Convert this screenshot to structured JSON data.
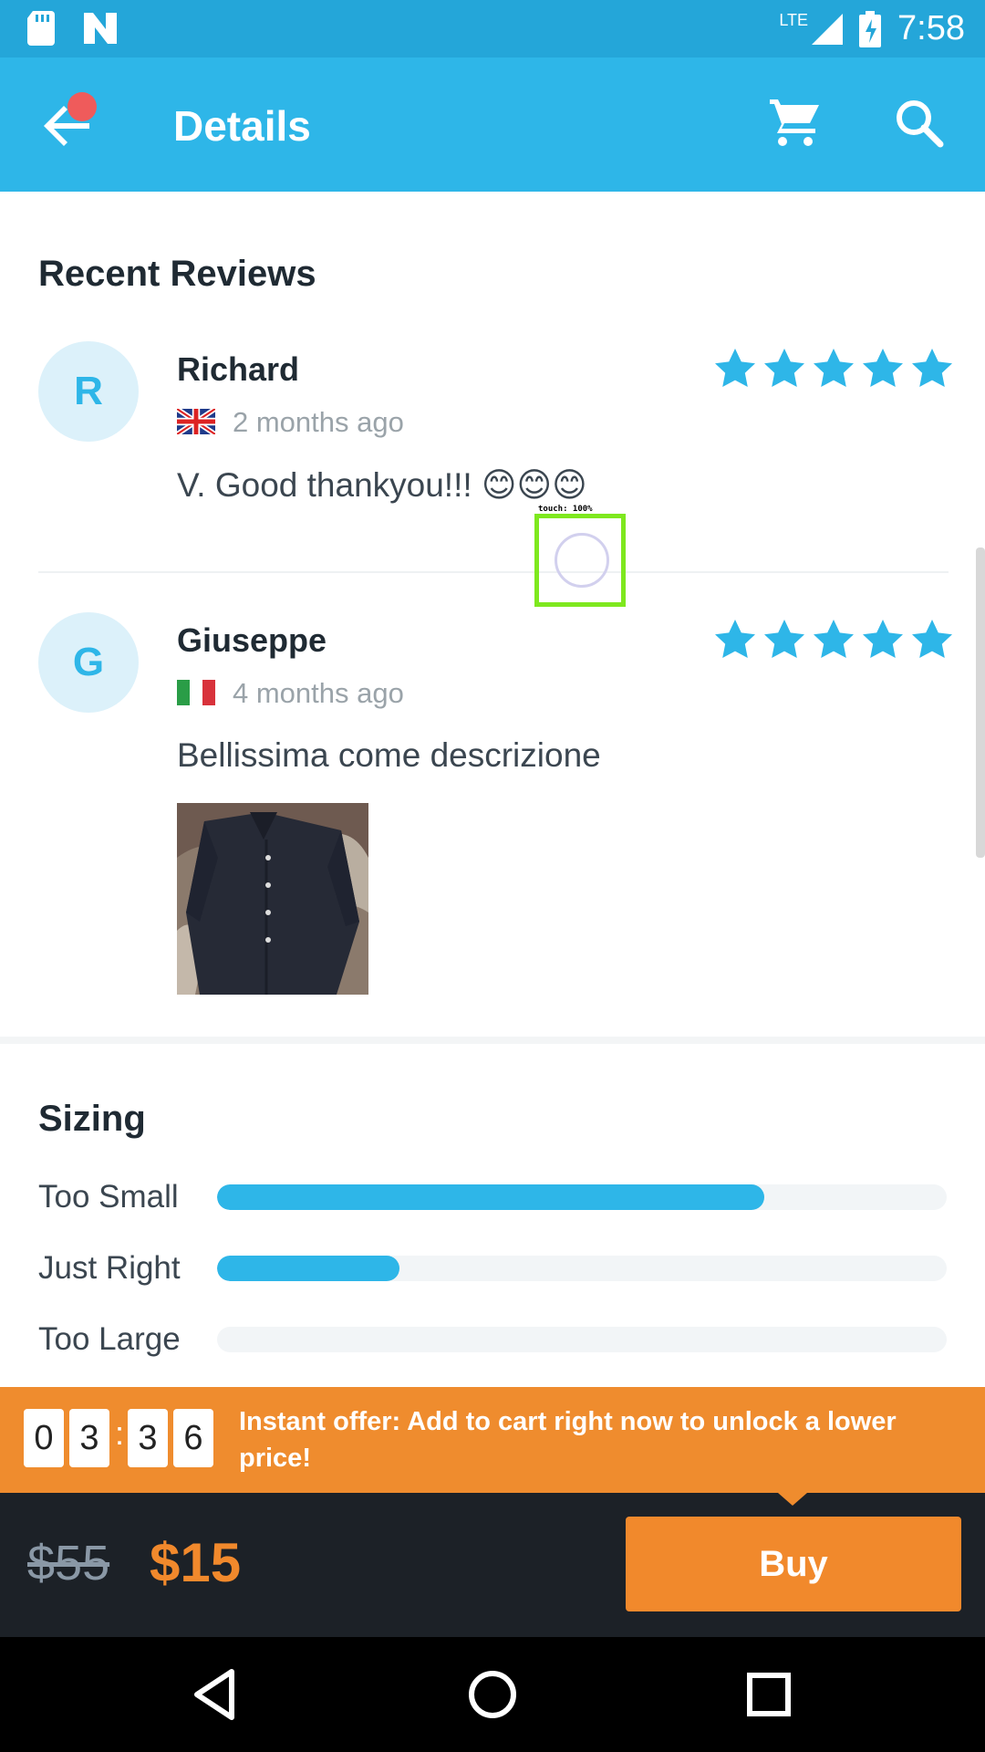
{
  "status_bar": {
    "time": "7:58",
    "network": "LTE"
  },
  "app_bar": {
    "title": "Details"
  },
  "reviews": {
    "title": "Recent Reviews",
    "items": [
      {
        "initial": "R",
        "name": "Richard",
        "ago": "2 months ago",
        "country": "UK",
        "text": "V. Good thankyou!!! 😊😊😊",
        "rating": 5
      },
      {
        "initial": "G",
        "name": "Giuseppe",
        "ago": "4 months ago",
        "country": "IT",
        "text": "Bellissima come descrizione",
        "rating": 5
      }
    ]
  },
  "sizing": {
    "title": "Sizing",
    "rows": [
      {
        "label": "Too Small",
        "fraction": 0.75
      },
      {
        "label": "Just Right",
        "fraction": 0.25
      },
      {
        "label": "Too Large",
        "fraction": 0.0
      }
    ]
  },
  "offer": {
    "countdown": [
      "0",
      "3",
      "3",
      "6"
    ],
    "separator": ":",
    "text": "Instant offer: Add to cart right now to unlock a lower price!"
  },
  "buy_bar": {
    "old_price": "$55",
    "new_price": "$15",
    "buy_label": "Buy"
  },
  "touch_overlay": {
    "label": "touch: 100%"
  },
  "colors": {
    "accent": "#2eb6e8",
    "orange": "#f1892c",
    "dark": "#1c2127"
  }
}
